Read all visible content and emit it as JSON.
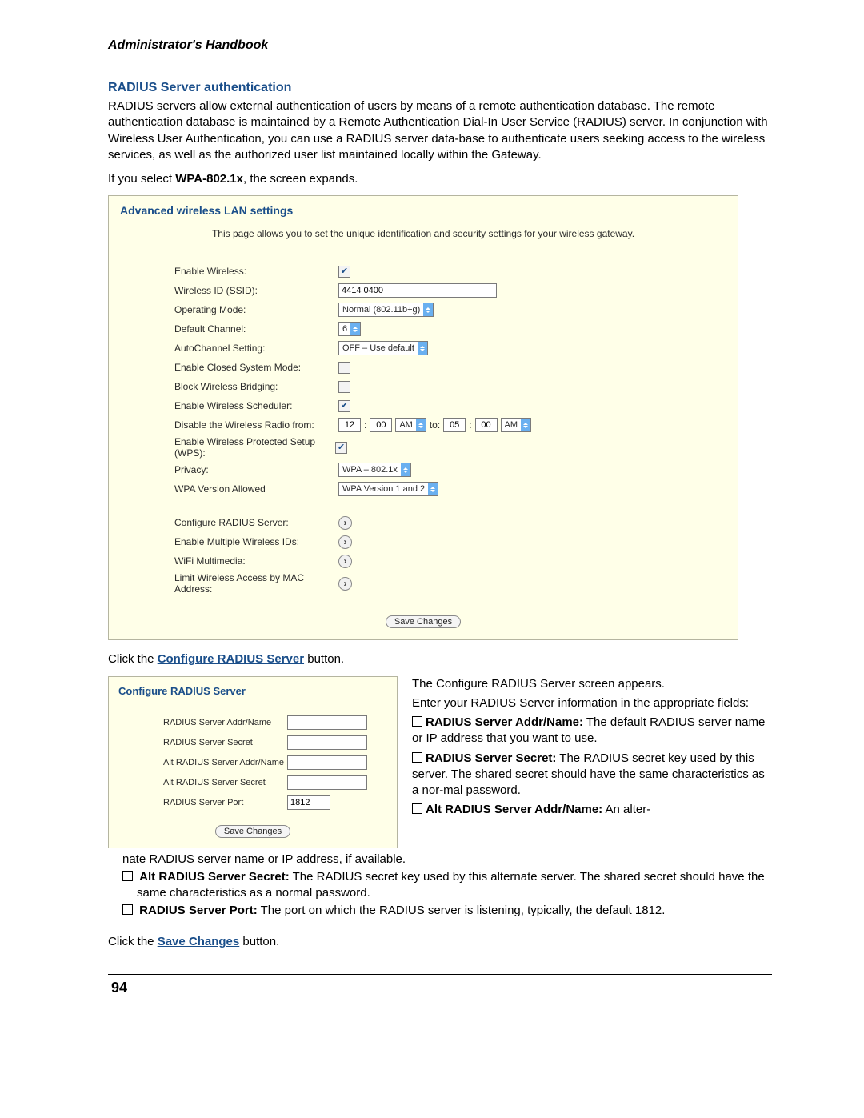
{
  "header": "Administrator's Handbook",
  "section_title": "RADIUS Server authentication",
  "intro_para": "RADIUS servers allow external authentication of users by means of a remote authentication database. The remote authentication database is maintained by a Remote Authentication Dial-In User Service (RADIUS) server. In conjunction with Wireless User Authentication, you can use a RADIUS server data-base to authenticate users seeking access to the wireless services, as well as the authorized user list maintained locally within the Gateway.",
  "select_prefix": "If you select ",
  "select_bold": "WPA-802.1x",
  "select_suffix": ", the screen expands.",
  "panel1": {
    "title": "Advanced wireless LAN settings",
    "subtitle": "This page allows you to set the unique identification and security settings for your wireless gateway.",
    "rows": {
      "enable_wireless": "Enable Wireless:",
      "ssid_label": "Wireless ID (SSID):",
      "ssid_value": "4414 0400",
      "op_mode_label": "Operating Mode:",
      "op_mode_value": "Normal (802.11b+g)",
      "def_channel_label": "Default Channel:",
      "def_channel_value": "6",
      "autochannel_label": "AutoChannel Setting:",
      "autochannel_value": "OFF – Use default",
      "closed_label": "Enable Closed System Mode:",
      "block_label": "Block Wireless Bridging:",
      "sched_label": "Enable Wireless Scheduler:",
      "disable_from_label": "Disable the Wireless Radio from:",
      "t1h": "12",
      "t1m": "00",
      "am1": "AM",
      "to": "to:",
      "t2h": "05",
      "t2m": "00",
      "am2": "AM",
      "wps_label": "Enable Wireless Protected Setup (WPS):",
      "privacy_label": "Privacy:",
      "privacy_value": "WPA – 802.1x",
      "wpa_ver_label": "WPA Version Allowed",
      "wpa_ver_value": "WPA Version 1 and 2",
      "cfg_radius": "Configure RADIUS Server:",
      "multi_ssid": "Enable Multiple Wireless IDs:",
      "wmm": "WiFi Multimedia:",
      "mac_limit": "Limit Wireless Access by MAC Address:",
      "save": "Save Changes"
    }
  },
  "click1_prefix": "Click the ",
  "click1_link": "Configure RADIUS Server",
  "click1_suffix": " button.",
  "panel2": {
    "title": "Configure RADIUS Server",
    "addr_label": "RADIUS Server Addr/Name",
    "secret_label": "RADIUS Server Secret",
    "alt_addr_label": "Alt RADIUS Server Addr/Name",
    "alt_secret_label": "Alt RADIUS Server Secret",
    "port_label": "RADIUS Server Port",
    "port_value": "1812",
    "save": "Save Changes"
  },
  "right": {
    "line1": "The Configure RADIUS Server screen appears.",
    "line2": "Enter your RADIUS Server information in the appropriate fields:",
    "b1_bold": "RADIUS Server Addr/Name:",
    "b1_rest": " The default RADIUS server name or IP address that you want to use.",
    "b2_bold": "RADIUS Server Secret:",
    "b2_rest": " The RADIUS secret key used by this server. The shared secret should have the same characteristics as a nor-mal password.",
    "b3_bold": "Alt RADIUS Server Addr/Name:",
    "b3_rest": " An alter-"
  },
  "cont": {
    "l1": "nate RADIUS server name or IP address, if available.",
    "b4_bold": "Alt RADIUS Server Secret:",
    "b4_rest": " The RADIUS secret key used by this alternate server. The shared secret should have the same characteristics as a normal password.",
    "b5_bold": "RADIUS Server Port:",
    "b5_rest": " The port on which the RADIUS server is listening, typically, the default 1812."
  },
  "click2_prefix": "Click the ",
  "click2_link": "Save Changes",
  "click2_suffix": " button.",
  "page_number": "94"
}
